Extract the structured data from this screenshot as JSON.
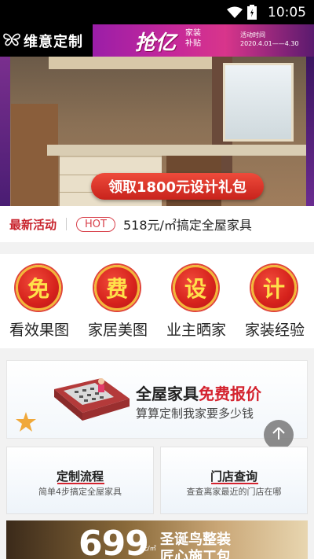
{
  "status_bar": {
    "time": "10:05"
  },
  "header": {
    "brand_name": "维意定制",
    "promo_big": "抢亿",
    "promo_sub": "家装补贴",
    "promo_time_label": "活动时间",
    "promo_time_range": "2020.4.01——4.30"
  },
  "hero": {
    "cta_label": "领取1800元设计礼包",
    "active_slide": 2,
    "slide_count": 2
  },
  "news": {
    "label": "最新活动",
    "badge": "HOT",
    "text": "518元/㎡搞定全屋家具"
  },
  "categories": [
    {
      "glyph": "免",
      "label": "看效果图"
    },
    {
      "glyph": "费",
      "label": "家居美图"
    },
    {
      "glyph": "设",
      "label": "业主晒家"
    },
    {
      "glyph": "计",
      "label": "家装经验"
    }
  ],
  "quote_banner": {
    "title_black": "全屋家具",
    "title_red": "免费报价",
    "subtitle": "算算定制我家要多少钱"
  },
  "cards": [
    {
      "title": "定制流程",
      "subtitle": "简单4步搞定全屋家具"
    },
    {
      "title": "门店查询",
      "subtitle": "查查离家最近的门店在哪"
    }
  ],
  "bottom_banner": {
    "price": "699",
    "unit": "元/㎡",
    "title": "圣诞鸟整装",
    "subtitle": "匠心施工包"
  },
  "colors": {
    "accent_red": "#d4232f",
    "gold": "#f0c31e"
  },
  "icons": [
    "wifi-icon",
    "battery-icon",
    "butterfly-logo-icon",
    "back-to-top-icon",
    "calculator-icon",
    "starfish-icon"
  ]
}
